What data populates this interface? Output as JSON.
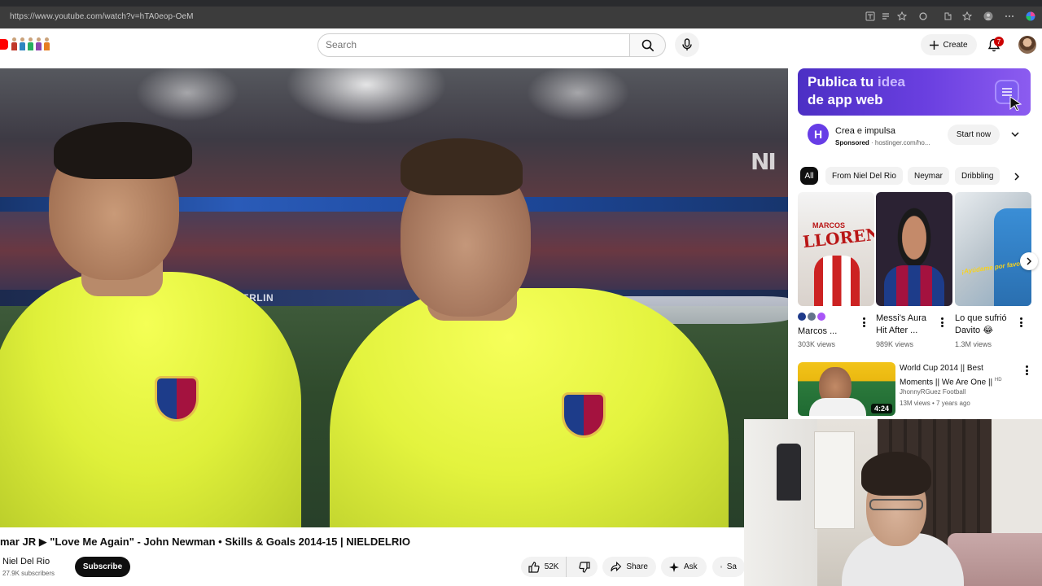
{
  "browser": {
    "url": "https://www.youtube.com/watch?v=hTA0eop-OeM",
    "icons": [
      "translate-icon",
      "reader-icon",
      "star-icon",
      "extension-icon",
      "bookmark-icon",
      "profile-icon",
      "menu-icon"
    ]
  },
  "header": {
    "search_placeholder": "Search",
    "create_label": "Create",
    "notification_count": "7"
  },
  "player": {
    "board_text": "ROAD TO BERLIN",
    "watermark": "NI"
  },
  "video": {
    "title": "mar JR ▶ \"Love Me Again\" - John Newman • Skills & Goals 2014-15 | NIELDELRIO",
    "channel": "Niel Del Rio",
    "subscribers": "27.9K subscribers",
    "subscribe_label": "Subscribe",
    "likes": "52K",
    "share_label": "Share",
    "ask_label": "Ask",
    "save_label": "Sa"
  },
  "ad": {
    "headline_1": "Publica tu ",
    "headline_highlight": "idea",
    "headline_2": "de app web",
    "logo_letter": "H",
    "title": "Crea e impulsa",
    "sponsored": "Sponsored",
    "domain": " · hostinger.com/ho...",
    "cta": "Start now"
  },
  "chips": [
    "All",
    "From Niel Del Rio",
    "Neymar",
    "Dribbling"
  ],
  "shorts": [
    {
      "thumb_small": "MARCOS",
      "thumb_big": "LLORENTE",
      "title": "Marcos ...",
      "views": "303K views"
    },
    {
      "title_line1": "Messi's Aura",
      "title_line2": "Hit After ...",
      "views": "989K views"
    },
    {
      "title_line1": "Lo que sufrió",
      "title_line2": "Davito 😂",
      "caption": "¡Ayúdame por favor!",
      "views": "1.3M views"
    }
  ],
  "recommended": {
    "title_line1": "World Cup 2014 || Best",
    "title_line2": "Moments || We Are One ||",
    "hd": "HD",
    "channel": "JhonnyRGuez Football",
    "meta": "13M views • 7 years ago",
    "duration": "4:24"
  },
  "colors": {
    "yt_red": "#ff0000",
    "ad_purple": "#673de6",
    "chip_active": "#0f0f0f",
    "jersey_yellow": "#e3f33e"
  }
}
